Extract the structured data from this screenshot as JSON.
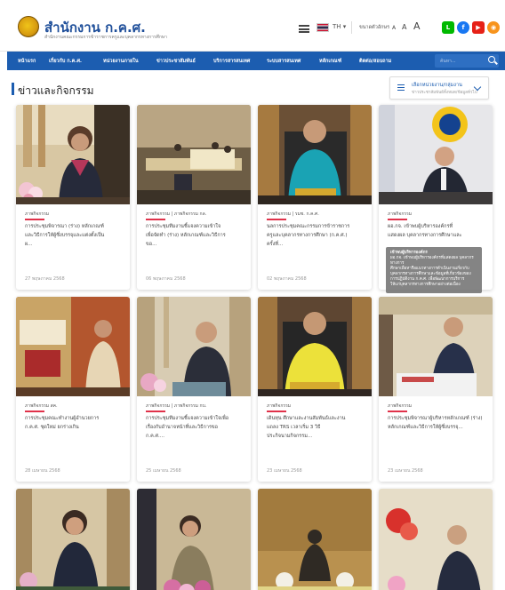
{
  "header": {
    "org_name": "สำนักงาน ก.ค.ศ.",
    "org_sub": "สำนักงานคณะกรรมการข้าราชการครูและบุคลากรทางการศึกษา",
    "lang": "TH ▾",
    "contrast_label": "ขนาดตัวอักษร",
    "font_small": "A",
    "font_medium": "A",
    "font_large": "A",
    "social": [
      "line-icon",
      "facebook-icon",
      "youtube-icon",
      "rss-icon"
    ]
  },
  "nav": {
    "items": [
      "หน้าแรก",
      "เกี่ยวกับ ก.ค.ศ.",
      "หน่วยงานภายใน",
      "ข่าวประชาสัมพันธ์",
      "บริการสารสนเทศ",
      "ระบบสารสนเทศ",
      "หลักเกณฑ์",
      "ติดต่อ/สอบถาม"
    ],
    "search_placeholder": "ค้นหา..."
  },
  "section": {
    "title": "ข่าวและกิจกรรม",
    "filter_label": "เลือกหน่วยงาน/กลุ่มงาน",
    "filter_sub": "ข่าวประชาสัมพันธ์ทั้งหมด/ข้อมูลทั่วไป"
  },
  "cards": [
    {
      "category": "ภาพกิจกรรม",
      "title": [
        "การประชุมพิจารณา (ร่าง) หลักเกณฑ์",
        "และวิธีการให้ผู้ซึ่งบรรจุและแต่งตั้งเป็น",
        "ผ..."
      ],
      "date": "27 พฤษภาคม 2568"
    },
    {
      "category": "ภาพกิจกรรม | ภาพกิจกรรม กล.",
      "title": [
        "การประชุมทีมงานชี้แจงความเข้าใจ",
        "เพื่อจัดทำ (ร่าง) หลักเกณฑ์และวิธีการ",
        "ขอ..."
      ],
      "date": "06 พฤษภาคม 2568"
    },
    {
      "category": "ภาพกิจกรรม | รมช. ก.ค.ศ.",
      "title": [
        "นลการประชุมคณะกรรมการข้าราชการ",
        "ครูและบุคลากรทางการศึกษา (ก.ค.ศ.)",
        "ครั้งที่..."
      ],
      "date": "02 พฤษภาคม 2568"
    },
    {
      "category": "ภาพกิจกรรม",
      "title": [
        "ผอ.กจ. เข้าพบผู้บริหารองค์กรที่",
        "แสดงผล บุคลากรทางการศึกษาและ",
        ""
      ],
      "date": ""
    },
    {
      "category": "ภาพกิจกรรม สค.",
      "title": [
        "การประชุมคณะทำงานผู้อำนวยการ",
        "ก.ค.ศ. ชุดใหม่ ยกร่างเกิน",
        ""
      ],
      "date": "28 เมษายน 2568"
    },
    {
      "category": "ภาพกิจกรรม | ภาพกิจกรรม กบ.",
      "title": [
        "การประชุมทีมงานชี้แจงความเข้าใจเพื่อ",
        "เรื่องกับอำนาจหน้าที่และวิธีการขอ",
        "ก.ค.ศ...."
      ],
      "date": "25 เมษายน 2568"
    },
    {
      "category": "ภาพกิจกรรม",
      "title": [
        "เดินทุน ศึกษาและงานสัมพันธ์และงาน",
        "แถลง TRS เวลาเริ่ม 3 วิธี",
        "ประกิจนามกิจกรรม..."
      ],
      "date": "23 เมษายน 2568"
    },
    {
      "category": "ภาพกิจกรรม",
      "title": [
        "การประชุมพิจารณาผู้บริหารหลักเกณฑ์ (ร่าง)",
        "หลักเกณฑ์และวิธีการให้ผู้ซึ่งบรรจุ...",
        ""
      ],
      "date": "23 เมษายน 2568"
    },
    {
      "category": "",
      "title": [
        "",
        "",
        ""
      ],
      "date": ""
    },
    {
      "category": "",
      "title": [
        "",
        "",
        ""
      ],
      "date": ""
    },
    {
      "category": "",
      "title": [
        "",
        "",
        ""
      ],
      "date": ""
    },
    {
      "category": "",
      "title": [
        "",
        "",
        ""
      ],
      "date": ""
    }
  ],
  "tooltip": {
    "title": "เข้าพบผู้บริหารองค์กร",
    "lines": [
      "ผอ.กจ. เข้าพบผู้บริหารองค์กรที่แสดงผล บุคลากรทางการ",
      "ศึกษาเพื่อหารือแนวทางการดำเนินงานเกี่ยวกับ",
      "บุคลากรทางการศึกษาและข้อมูลที่เกี่ยวข้องของ",
      "การปฏิบัติงาน ก.ค.ศ. เพื่อพัฒนาการบริการ",
      "ให้แก่บุคลากรทางการศึกษาอย่างต่อเนื่อง"
    ]
  }
}
